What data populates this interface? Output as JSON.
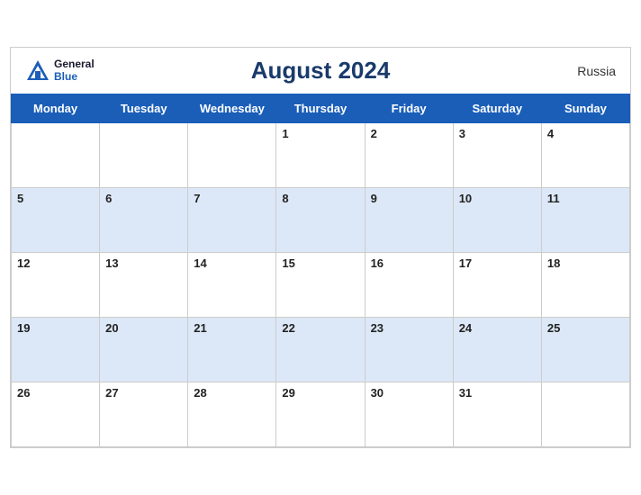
{
  "header": {
    "title": "August 2024",
    "country": "Russia",
    "logo_general": "General",
    "logo_blue": "Blue"
  },
  "days_of_week": [
    "Monday",
    "Tuesday",
    "Wednesday",
    "Thursday",
    "Friday",
    "Saturday",
    "Sunday"
  ],
  "weeks": [
    [
      null,
      null,
      null,
      1,
      2,
      3,
      4
    ],
    [
      5,
      6,
      7,
      8,
      9,
      10,
      11
    ],
    [
      12,
      13,
      14,
      15,
      16,
      17,
      18
    ],
    [
      19,
      20,
      21,
      22,
      23,
      24,
      25
    ],
    [
      26,
      27,
      28,
      29,
      30,
      31,
      null
    ]
  ]
}
